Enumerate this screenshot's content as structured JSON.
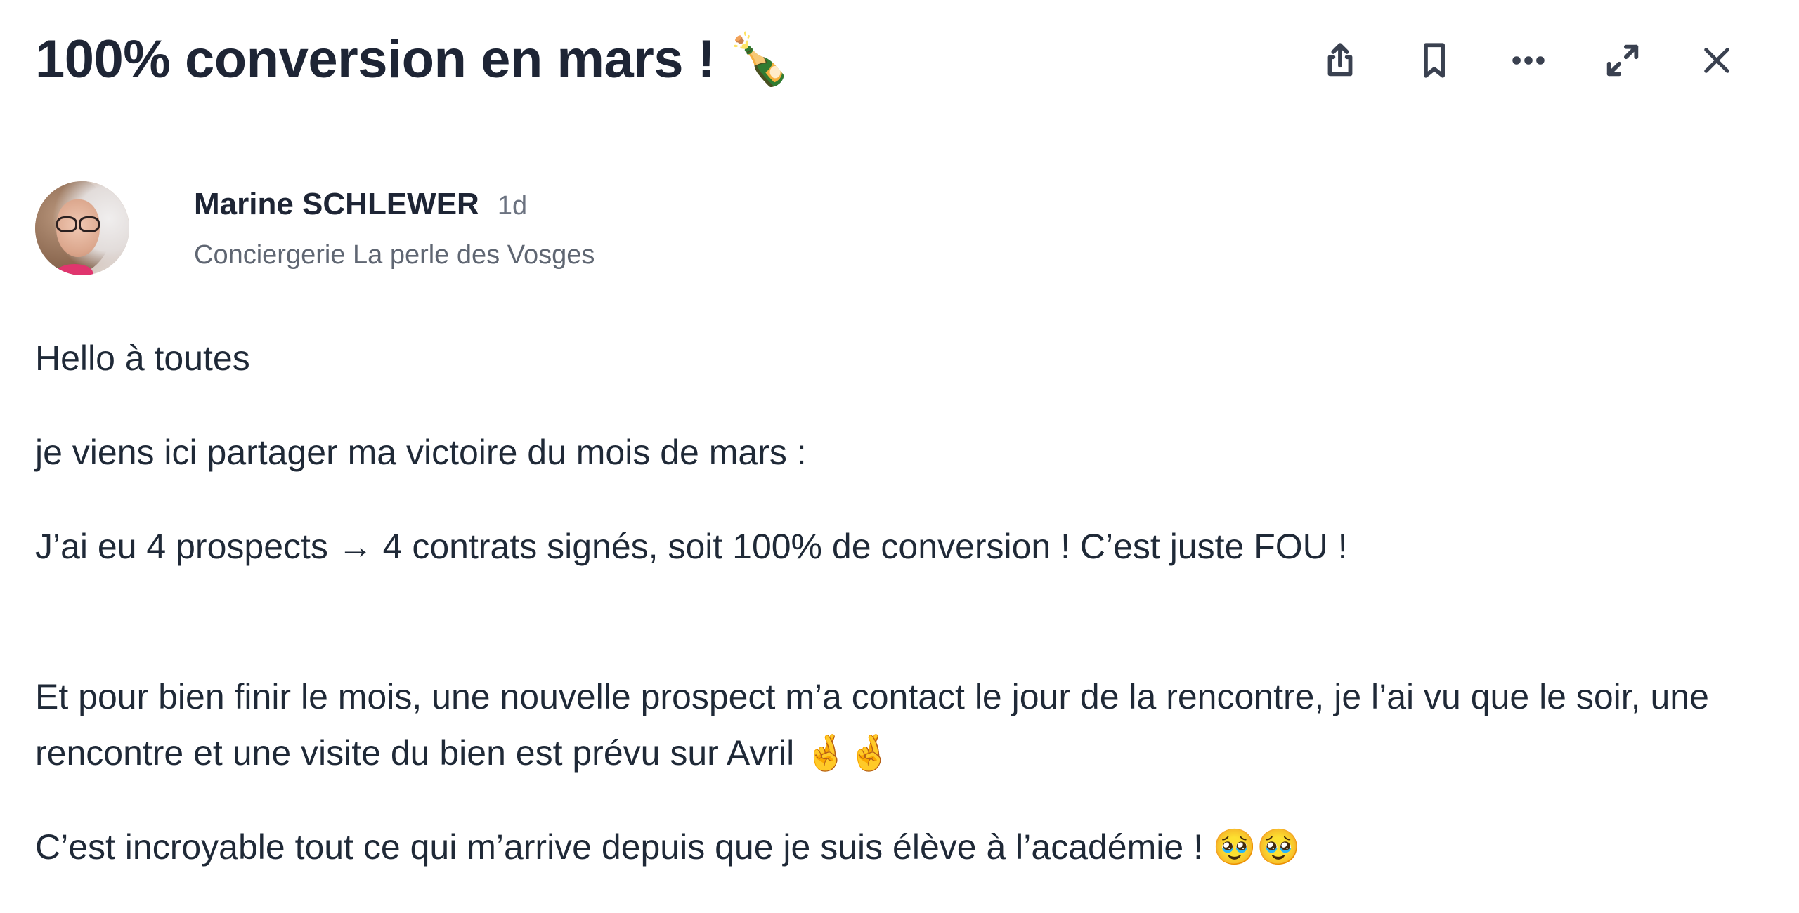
{
  "post": {
    "title": "100% conversion en mars !",
    "title_emoji": "🍾",
    "author": {
      "name": "Marine SCHLEWER",
      "age": "1d",
      "company": "Conciergerie La perle des Vosges"
    },
    "paragraphs": [
      "Hello à toutes",
      "je viens ici partager ma victoire du mois de mars :",
      "J’ai eu 4 prospects → 4 contrats signés, soit 100% de conversion ! C’est juste FOU !",
      "Et pour bien finir le mois, une nouvelle prospect m’a contact le jour de la rencontre, je l’ai vu que le soir, une rencontre et une visite du bien est prévu sur Avril 🤞🤞",
      "C’est incroyable tout ce qui m’arrive depuis que je suis élève à l’académie ! 🥹🥹"
    ]
  },
  "actions": [
    {
      "name": "share",
      "icon": "share-icon"
    },
    {
      "name": "bookmark",
      "icon": "bookmark-icon"
    },
    {
      "name": "more",
      "icon": "more-horizontal-icon"
    },
    {
      "name": "expand",
      "icon": "expand-icon"
    },
    {
      "name": "close",
      "icon": "close-icon"
    }
  ],
  "colors": {
    "title": "#1e2535",
    "text": "#1f2937",
    "muted": "#6b7280",
    "icon": "#3a4150",
    "background": "#ffffff"
  }
}
